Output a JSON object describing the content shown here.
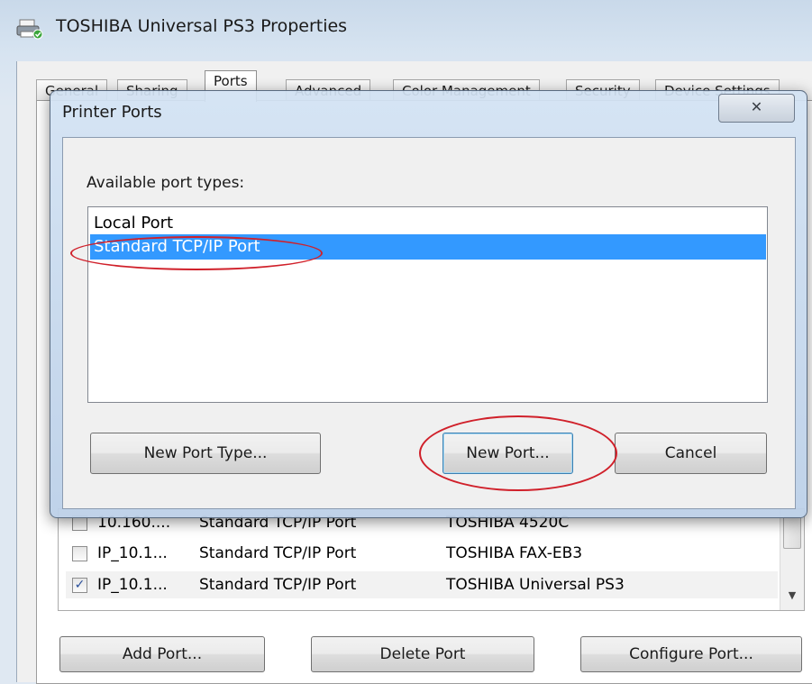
{
  "outer_window": {
    "title": "TOSHIBA Universal PS3 Properties",
    "tabs": [
      {
        "label": "General"
      },
      {
        "label": "Sharing"
      },
      {
        "label": "Ports",
        "active": true
      },
      {
        "label": "Advanced"
      },
      {
        "label": "Color Management"
      },
      {
        "label": "Security"
      },
      {
        "label": "Device Settings"
      }
    ],
    "ports": [
      {
        "checked": false,
        "port": "10.160....",
        "description": "Standard TCP/IP Port",
        "printer": "TOSHIBA 4520C"
      },
      {
        "checked": false,
        "port": "IP_10.1...",
        "description": "Standard TCP/IP Port",
        "printer": "TOSHIBA FAX-EB3"
      },
      {
        "checked": true,
        "port": "IP_10.1...",
        "description": "Standard TCP/IP Port",
        "printer": "TOSHIBA Universal PS3"
      }
    ],
    "buttons": {
      "add_port": "Add Port...",
      "delete_port": "Delete Port",
      "configure_port": "Configure Port..."
    }
  },
  "dialog": {
    "title": "Printer Ports",
    "close_glyph": "✕",
    "label": "Available port types:",
    "port_types": [
      {
        "label": "Local Port",
        "selected": false
      },
      {
        "label": "Standard TCP/IP Port",
        "selected": true
      }
    ],
    "buttons": {
      "new_port_type": "New Port Type...",
      "new_port": "New Port...",
      "cancel": "Cancel"
    }
  },
  "colors": {
    "selection": "#3399ff",
    "annotation": "#d0202a"
  }
}
